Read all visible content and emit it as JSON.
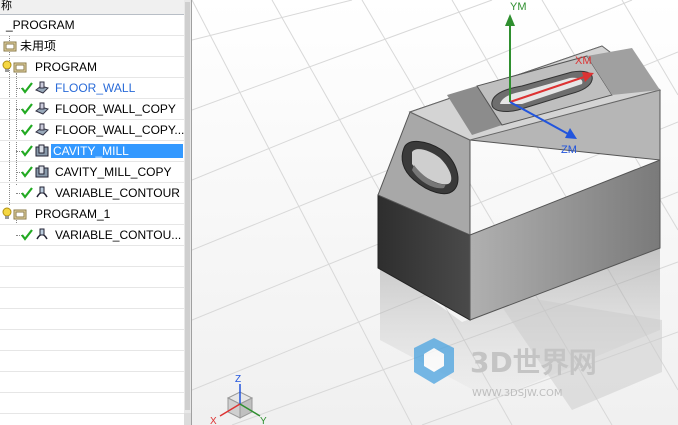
{
  "navigator": {
    "header": "称",
    "items": [
      {
        "label": "_PROGRAM",
        "type": "root",
        "selected": false
      },
      {
        "label": "未用项",
        "type": "group"
      },
      {
        "label": "PROGRAM",
        "type": "program"
      },
      {
        "label": "FLOOR_WALL",
        "type": "op-floor",
        "status": "ok",
        "highlight": true
      },
      {
        "label": "FLOOR_WALL_COPY",
        "type": "op-floor",
        "status": "ok"
      },
      {
        "label": "FLOOR_WALL_COPY...",
        "type": "op-floor",
        "status": "ok"
      },
      {
        "label": "CAVITY_MILL",
        "type": "op-cavity",
        "status": "ok",
        "selected": true
      },
      {
        "label": "CAVITY_MILL_COPY",
        "type": "op-cavity",
        "status": "ok"
      },
      {
        "label": "VARIABLE_CONTOUR",
        "type": "op-contour",
        "status": "ok"
      },
      {
        "label": "PROGRAM_1",
        "type": "program"
      },
      {
        "label": "VARIABLE_CONTOU...",
        "type": "op-contour",
        "status": "ok"
      }
    ]
  },
  "viewport": {
    "axes_labels": {
      "ym": "YM",
      "xm": "XM",
      "zm": "ZM"
    },
    "triad_labels": {
      "z": "Z",
      "x": "X",
      "y": "Y"
    },
    "watermark": {
      "main": "3D世界网",
      "sub": "WWW.3DSJW.COM"
    }
  },
  "colors": {
    "selection": "#3399ff",
    "check": "#22aa22",
    "axis_y": "#2f8f2f",
    "axis_x": "#d33",
    "axis_z": "#2255dd"
  }
}
